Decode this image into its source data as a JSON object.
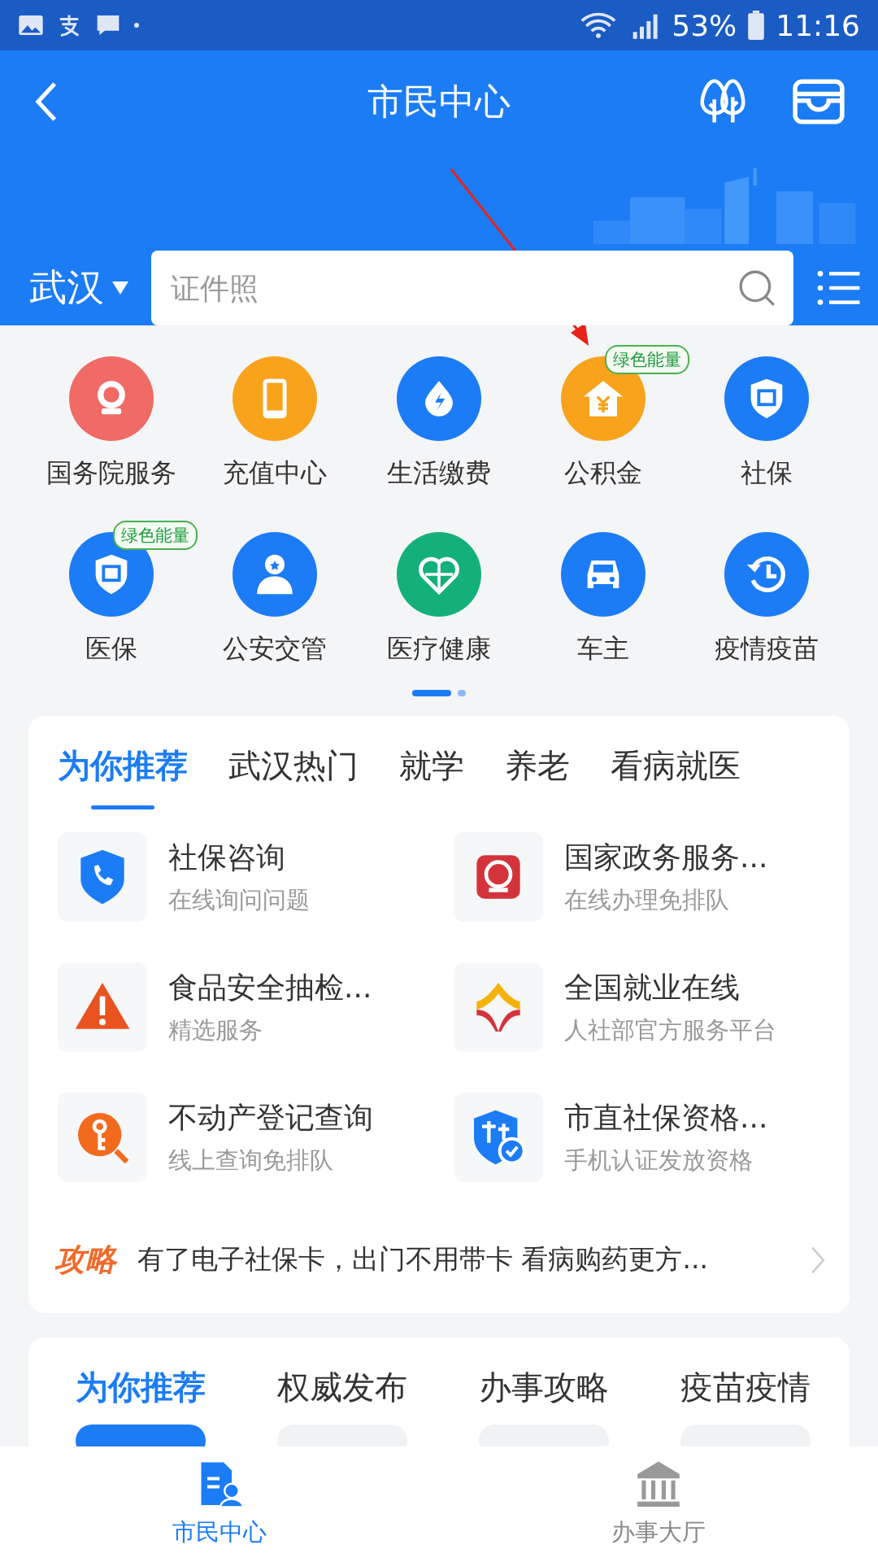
{
  "status_bar": {
    "battery": "53%",
    "time": "11:16"
  },
  "header": {
    "title": "市民中心",
    "city": "武汉",
    "search": {
      "placeholder": "证件照"
    }
  },
  "services": [
    {
      "label": "国务院服务"
    },
    {
      "label": "充值中心"
    },
    {
      "label": "生活缴费"
    },
    {
      "label": "公积金",
      "badge": "绿色能量"
    },
    {
      "label": "社保"
    },
    {
      "label": "医保",
      "badge": "绿色能量"
    },
    {
      "label": "公安交管"
    },
    {
      "label": "医疗健康"
    },
    {
      "label": "车主"
    },
    {
      "label": "疫情疫苗"
    }
  ],
  "pager": [
    {
      "selected": true
    },
    {
      "selected": false
    }
  ],
  "recommend": {
    "tabs": [
      {
        "label": "为你推荐",
        "selected": true
      },
      {
        "label": "武汉热门",
        "selected": false
      },
      {
        "label": "就学",
        "selected": false
      },
      {
        "label": "养老",
        "selected": false
      },
      {
        "label": "看病就医",
        "selected": false
      }
    ],
    "items": [
      {
        "title": "社保咨询",
        "subtitle": "在线询问问题"
      },
      {
        "title": "国家政务服务...",
        "subtitle": "在线办理免排队"
      },
      {
        "title": "食品安全抽检...",
        "subtitle": "精选服务"
      },
      {
        "title": "全国就业在线",
        "subtitle": "人社部官方服务平台"
      },
      {
        "title": "不动产登记查询",
        "subtitle": "线上查询免排队"
      },
      {
        "title": "市直社保资格...",
        "subtitle": "手机认证发放资格"
      }
    ],
    "tip": {
      "tag": "攻略",
      "text": "有了电子社保卡，出门不用带卡 看病购药更方..."
    }
  },
  "news": {
    "tabs": [
      {
        "label": "为你推荐",
        "selected": true
      },
      {
        "label": "权威发布",
        "selected": false
      },
      {
        "label": "办事攻略",
        "selected": false
      },
      {
        "label": "疫苗疫情",
        "selected": false
      }
    ]
  },
  "bottom_nav": [
    {
      "label": "市民中心",
      "selected": true
    },
    {
      "label": "办事大厅",
      "selected": false
    }
  ]
}
